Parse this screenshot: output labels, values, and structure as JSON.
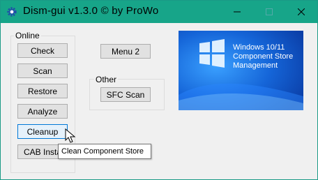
{
  "window": {
    "title": "Dism-gui v1.3.0    © by ProWo",
    "title_bg": "#17a589"
  },
  "groups": {
    "online_label": "Online",
    "other_label": "Other"
  },
  "buttons": {
    "check": "Check",
    "scan": "Scan",
    "restore": "Restore",
    "analyze": "Analyze",
    "cleanup": "Cleanup",
    "cab_install": "CAB Insta",
    "menu2": "Menu 2",
    "sfc_scan": "SFC Scan"
  },
  "banner": {
    "line1": "Windows 10/11",
    "line2": "Component Store",
    "line3": "Management"
  },
  "tooltip": {
    "text": "Clean Component Store"
  },
  "icons": {
    "app": "gear-icon",
    "minimize": "minimize-icon",
    "maximize": "maximize-icon",
    "close": "close-icon",
    "windows_logo": "windows-logo-icon",
    "cursor": "mouse-pointer-icon"
  }
}
